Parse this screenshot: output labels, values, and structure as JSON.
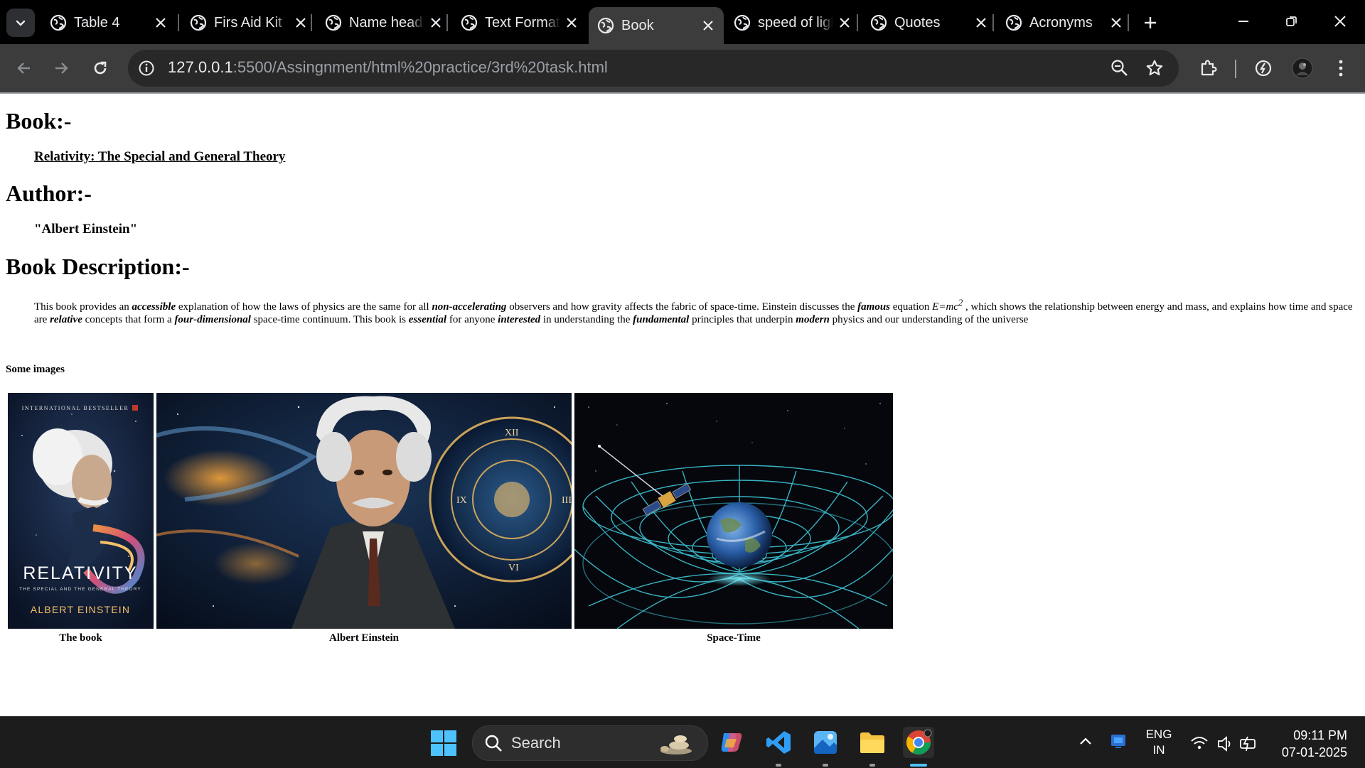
{
  "browser": {
    "tabs": [
      {
        "label": "Table 4",
        "active": false
      },
      {
        "label": "Firs Aid Kit",
        "active": false
      },
      {
        "label": "Name heading",
        "active": false
      },
      {
        "label": "Text Formatting",
        "active": false
      },
      {
        "label": "Book",
        "active": true
      },
      {
        "label": "speed of light",
        "active": false
      },
      {
        "label": "Quotes",
        "active": false
      },
      {
        "label": "Acronyms",
        "active": false
      }
    ],
    "url_host": "127.0.0.1",
    "url_path": ":5500/Assingnment/html%20practice/3rd%20task.html",
    "icons": {
      "back": "arrow-left-icon",
      "forward": "arrow-right-icon",
      "reload": "reload-icon",
      "info": "info-icon",
      "zoom": "zoom-icon",
      "bookmark": "star-icon",
      "extensions": "puzzle-icon",
      "performance": "speedometer-icon",
      "profile": "avatar-icon",
      "menu": "kebab-menu-icon"
    }
  },
  "page": {
    "book_heading": "Book:-",
    "book_title": "Relativity: The Special and General Theory",
    "author_heading": "Author:-",
    "author_name": "\"Albert Einstein\"",
    "desc_heading": "Book Description:-",
    "description": {
      "p1": "This book provides an ",
      "e1": "accessible",
      "p2": " explanation of how the laws of physics are the same for all ",
      "e2": "non-accelerating",
      "p3": " observers and how gravity affects the fabric of space-time. Einstein discusses the ",
      "e3": "famous",
      "p4": " equation ",
      "eq": "E=mc",
      "eq_sup": "2",
      "p5": " , which shows the relationship between energy and mass, and explains how time and space are ",
      "e4": "relative",
      "p6": " concepts that form a ",
      "e5": "four-dimensional",
      "p7": " space-time continuum. This book is ",
      "e6": "essential",
      "p8": " for anyone ",
      "e7": "interested",
      "p9": " in understanding the ",
      "e8": "fundamental",
      "p10": " principles that underpin ",
      "e9": "modern",
      "p11": " physics and our understanding of the universe"
    },
    "images_label": "Some images",
    "images": [
      {
        "caption": "The book",
        "cover_top": "INTERNATIONAL BESTSELLER",
        "cover_title": "RELATIVITY",
        "cover_subtitle": "THE SPECIAL AND THE GENERAL THEORY",
        "cover_author": "ALBERT EINSTEIN"
      },
      {
        "caption": "Albert Einstein"
      },
      {
        "caption": "Space-Time"
      }
    ]
  },
  "taskbar": {
    "search_label": "Search",
    "lang_top": "ENG",
    "lang_bottom": "IN",
    "time": "09:11 PM",
    "date": "07-01-2025"
  }
}
